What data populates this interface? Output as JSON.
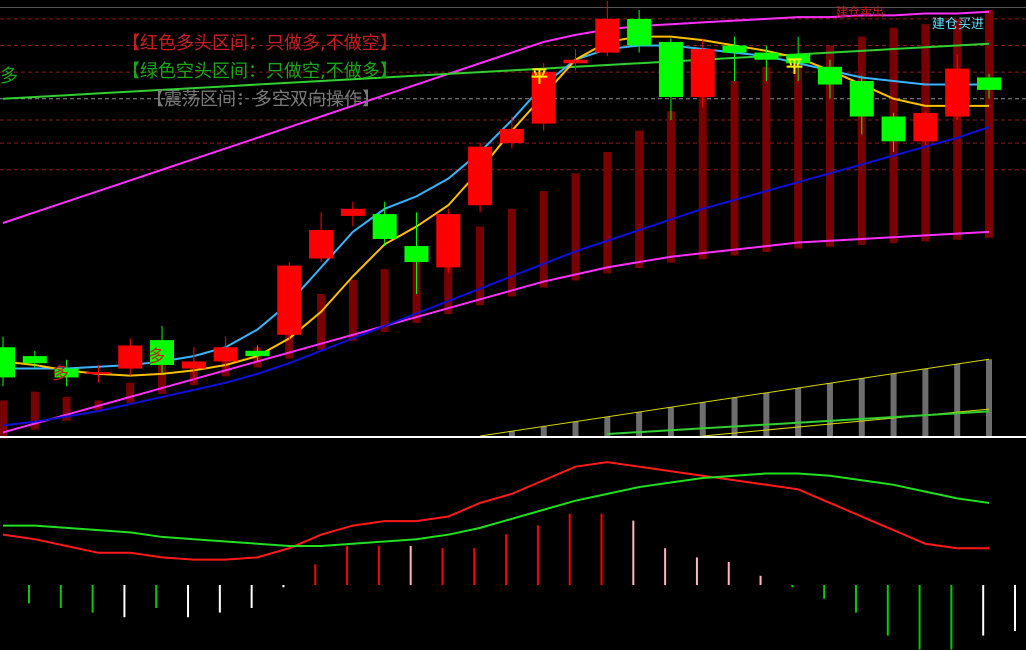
{
  "legend": {
    "red_zone": "【红色多头区间：只做多,不做空】",
    "green_zone": "【绿色空头区间：只做空,不做多】",
    "range_zone": "【震荡区间：多空双向操作】",
    "edge_label": "多"
  },
  "signals": {
    "long1": "多",
    "long2": "多",
    "flat1": "平",
    "flat2": "平",
    "open_buy": "建仓买进",
    "close_label": "建仓卖出"
  },
  "colors": {
    "up": "#ff0000",
    "down": "#00ff00",
    "ma_short": "#ffc000",
    "ma_fast": "#3ab4ff",
    "ma_long": "#1010d8",
    "ma_green": "#30d030",
    "channel": "#ff30ff",
    "background": "#000000"
  },
  "chart_data": [
    {
      "type": "candlestick",
      "panel": "price",
      "candles": [
        {
          "o": 330,
          "c": 313,
          "h": 336,
          "l": 308
        },
        {
          "o": 325,
          "c": 321,
          "h": 328,
          "l": 318
        },
        {
          "o": 318,
          "c": 313,
          "h": 323,
          "l": 308
        },
        {
          "o": 315,
          "c": 316,
          "h": 320,
          "l": 310
        },
        {
          "o": 318,
          "c": 331,
          "h": 335,
          "l": 314
        },
        {
          "o": 334,
          "c": 320,
          "h": 342,
          "l": 315
        },
        {
          "o": 318,
          "c": 322,
          "h": 330,
          "l": 310
        },
        {
          "o": 322,
          "c": 330,
          "h": 336,
          "l": 318
        },
        {
          "o": 328,
          "c": 325,
          "h": 331,
          "l": 322
        },
        {
          "o": 337,
          "c": 376,
          "h": 378,
          "l": 334
        },
        {
          "o": 380,
          "c": 396,
          "h": 406,
          "l": 378
        },
        {
          "o": 404,
          "c": 408,
          "h": 412,
          "l": 398
        },
        {
          "o": 405,
          "c": 391,
          "h": 412,
          "l": 387
        },
        {
          "o": 387,
          "c": 378,
          "h": 406,
          "l": 360
        },
        {
          "o": 375,
          "c": 405,
          "h": 408,
          "l": 372
        },
        {
          "o": 410,
          "c": 443,
          "h": 445,
          "l": 406
        },
        {
          "o": 445,
          "c": 453,
          "h": 460,
          "l": 442
        },
        {
          "o": 456,
          "c": 485,
          "h": 490,
          "l": 452
        },
        {
          "o": 490,
          "c": 492,
          "h": 498,
          "l": 486
        },
        {
          "o": 496,
          "c": 515,
          "h": 525,
          "l": 494
        },
        {
          "o": 515,
          "c": 500,
          "h": 520,
          "l": 496
        },
        {
          "o": 502,
          "c": 471,
          "h": 504,
          "l": 458
        },
        {
          "o": 471,
          "c": 498,
          "h": 504,
          "l": 465
        },
        {
          "o": 500,
          "c": 496,
          "h": 505,
          "l": 480
        },
        {
          "o": 496,
          "c": 492,
          "h": 500,
          "l": 480
        },
        {
          "o": 495,
          "c": 490,
          "h": 505,
          "l": 480
        },
        {
          "o": 488,
          "c": 478,
          "h": 492,
          "l": 470
        },
        {
          "o": 480,
          "c": 460,
          "h": 483,
          "l": 450
        },
        {
          "o": 460,
          "c": 446,
          "h": 462,
          "l": 440
        },
        {
          "o": 446,
          "c": 462,
          "h": 463,
          "l": 444
        },
        {
          "o": 460,
          "c": 487,
          "h": 495,
          "l": 458
        },
        {
          "o": 482,
          "c": 475,
          "h": 484,
          "l": 470
        }
      ],
      "ylim": [
        280,
        520
      ],
      "volume_bars": [
        300,
        305,
        302,
        300,
        310,
        320,
        318,
        322,
        330,
        345,
        360,
        368,
        374,
        380,
        388,
        398,
        408,
        418,
        428,
        440,
        452,
        463,
        472,
        480,
        488,
        495,
        500,
        505,
        510,
        512,
        515,
        520
      ],
      "ma_short": [
        322,
        320,
        317,
        315,
        314,
        315,
        317,
        320,
        325,
        335,
        350,
        370,
        388,
        398,
        410,
        430,
        452,
        472,
        492,
        502,
        505,
        505,
        503,
        500,
        497,
        493,
        486,
        478,
        470,
        466,
        466,
        466
      ],
      "ma_fast": [
        318,
        318,
        318,
        319,
        320,
        322,
        325,
        330,
        340,
        355,
        375,
        395,
        408,
        415,
        425,
        440,
        458,
        478,
        492,
        498,
        500,
        500,
        498,
        496,
        494,
        490,
        486,
        482,
        480,
        478,
        478,
        478
      ],
      "ma_long": [
        286,
        288,
        291,
        294,
        298,
        302,
        306,
        310,
        315,
        321,
        328,
        335,
        342,
        349,
        356,
        363,
        370,
        377,
        384,
        390,
        396,
        402,
        408,
        413,
        418,
        423,
        428,
        433,
        438,
        443,
        448,
        454
      ],
      "ma_green": [
        470,
        471,
        472,
        473,
        474,
        475,
        476,
        477,
        478,
        479,
        480,
        481,
        482,
        483,
        484,
        485,
        486,
        487,
        488,
        489,
        490,
        491,
        492,
        493,
        494,
        495,
        496,
        497,
        498,
        499,
        500,
        501
      ],
      "channel_upper": [
        400,
        406,
        412,
        418,
        424,
        430,
        436,
        442,
        448,
        454,
        460,
        466,
        472,
        478,
        484,
        490,
        496,
        502,
        506,
        509,
        511,
        512,
        513,
        514,
        515,
        516,
        516,
        517,
        517,
        518,
        518,
        519
      ],
      "channel_lower": [
        282,
        287,
        292,
        297,
        302,
        307,
        312,
        317,
        322,
        327,
        332,
        337,
        342,
        347,
        352,
        357,
        362,
        367,
        371,
        375,
        378,
        381,
        383,
        385,
        387,
        389,
        390,
        391,
        392,
        393,
        394,
        395
      ]
    },
    {
      "type": "bar",
      "panel": "volume",
      "values": [
        0,
        0,
        0,
        0,
        0,
        0,
        0,
        0,
        0,
        0,
        0,
        0,
        0,
        0,
        0,
        0,
        1,
        2,
        3,
        4,
        5,
        6,
        7,
        8,
        9,
        10,
        11,
        12,
        13,
        14,
        15,
        16
      ],
      "ylim": [
        0,
        20
      ]
    },
    {
      "type": "line+histogram",
      "panel": "macd",
      "macd": [
        20,
        18,
        15,
        12,
        12,
        10,
        9,
        9,
        10,
        14,
        20,
        24,
        26,
        26,
        28,
        34,
        38,
        44,
        50,
        52,
        50,
        48,
        46,
        44,
        42,
        40,
        34,
        28,
        22,
        16,
        14,
        14
      ],
      "signal": [
        24,
        24,
        23,
        22,
        21,
        19,
        18,
        17,
        16,
        15,
        15,
        16,
        17,
        18,
        20,
        23,
        27,
        31,
        35,
        38,
        41,
        43,
        45,
        46,
        47,
        47,
        46,
        44,
        42,
        39,
        36,
        34
      ],
      "histogram": [
        -8,
        -10,
        -12,
        -14,
        -10,
        -14,
        -12,
        -10,
        -1,
        9,
        17,
        17,
        17,
        16,
        16,
        22,
        26,
        31,
        31,
        28,
        16,
        12,
        10,
        4,
        -1,
        -6,
        -12,
        -22,
        -28,
        -28,
        -22,
        -20
      ],
      "hist_colors": [
        "#00cc00",
        "#00cc00",
        "#00cc00",
        "#ffffff",
        "#00cc00",
        "#ffffff",
        "#ffffff",
        "#ffffff",
        "#ffffff",
        "#ff0000",
        "#ff0000",
        "#ff0000",
        "#ffb6c1",
        "#ff0000",
        "#ff0000",
        "#ff0000",
        "#ff0000",
        "#ff0000",
        "#ff0000",
        "#ffb6c1",
        "#ffb6c1",
        "#ffb6c1",
        "#ffb6c1",
        "#ffb6c1",
        "#00cc00",
        "#00cc00",
        "#00cc00",
        "#00cc00",
        "#00cc00",
        "#00cc00",
        "#ffffff",
        "#ffffff"
      ],
      "ylim": [
        -30,
        60
      ]
    }
  ]
}
